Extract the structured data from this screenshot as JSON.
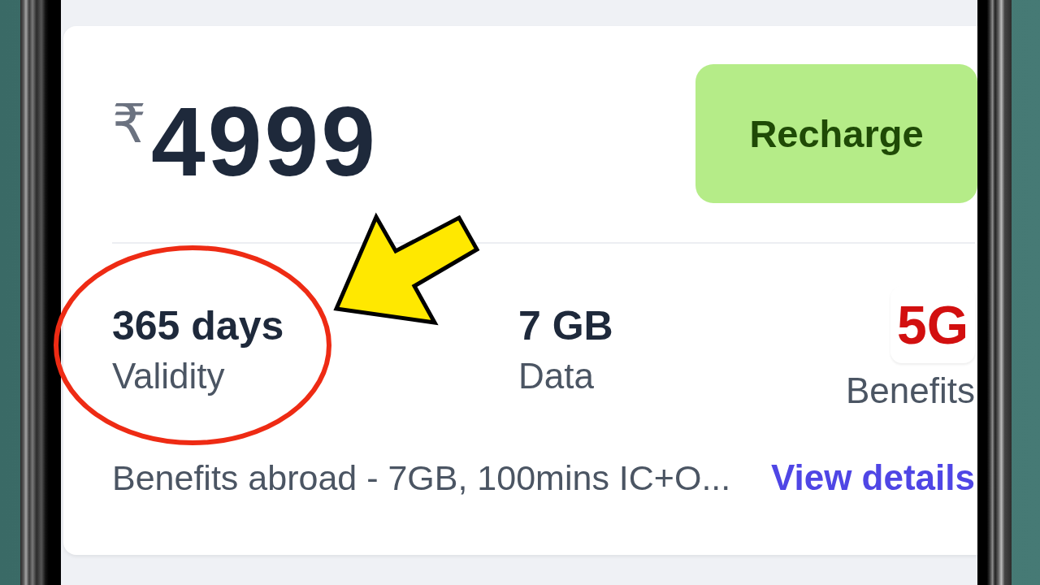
{
  "price": {
    "currency": "₹",
    "amount": "4999"
  },
  "recharge_button": {
    "label": "Recharge"
  },
  "stats": [
    {
      "kind": "text",
      "value": "365 days",
      "label": "Validity"
    },
    {
      "kind": "text",
      "value": "7 GB",
      "label": "Data"
    },
    {
      "kind": "logo",
      "value": "5G",
      "label": "Benefits"
    }
  ],
  "description": "Benefits abroad - 7GB, 100mins IC+O...",
  "details_link": "View details"
}
